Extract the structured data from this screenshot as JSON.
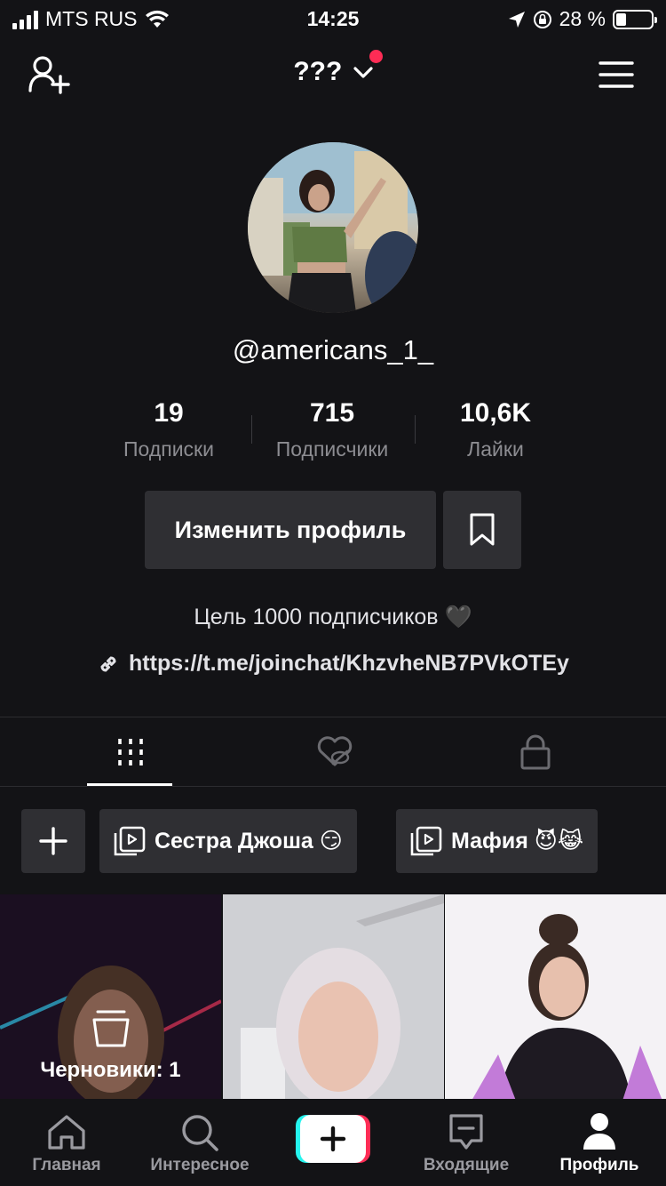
{
  "status_bar": {
    "carrier": "MTS RUS",
    "time": "14:25",
    "battery_percent": "28 %",
    "battery_level": 0.28
  },
  "top_nav": {
    "title": "???",
    "add_user_icon": "add-user-icon",
    "menu_icon": "hamburger-menu-icon",
    "notification_dot_color": "#fe2c55"
  },
  "profile": {
    "username": "@americans_1_",
    "stats": [
      {
        "value": "19",
        "label": "Подписки"
      },
      {
        "value": "715",
        "label": "Подписчики"
      },
      {
        "value": "10,6K",
        "label": "Лайки"
      }
    ],
    "edit_button": "Изменить профиль",
    "bio": "Цель 1000 подписчиков 🖤",
    "link": "https://t.me/joinchat/KhzvheNB7PVkOTEy"
  },
  "tabs": [
    {
      "name": "videos",
      "icon": "grid-icon",
      "active": true
    },
    {
      "name": "liked",
      "icon": "hidden-heart-icon",
      "active": false
    },
    {
      "name": "private",
      "icon": "lock-icon",
      "active": false
    }
  ],
  "playlists": [
    {
      "label": "Сестра Джоша 😏"
    },
    {
      "label": "Мафия 😈😹"
    }
  ],
  "grid": {
    "draft_label": "Черновики: 1"
  },
  "bottom_nav": [
    {
      "label": "Главная",
      "icon": "home-icon"
    },
    {
      "label": "Интересное",
      "icon": "search-icon"
    },
    {
      "label": "",
      "icon": "create-plus-icon"
    },
    {
      "label": "Входящие",
      "icon": "inbox-icon"
    },
    {
      "label": "Профиль",
      "icon": "profile-icon",
      "active": true
    }
  ],
  "colors": {
    "background": "#131316",
    "button": "#2f2f33",
    "accent_red": "#fe2c55",
    "accent_cyan": "#25f4ee",
    "muted_text": "#8d8d92"
  }
}
